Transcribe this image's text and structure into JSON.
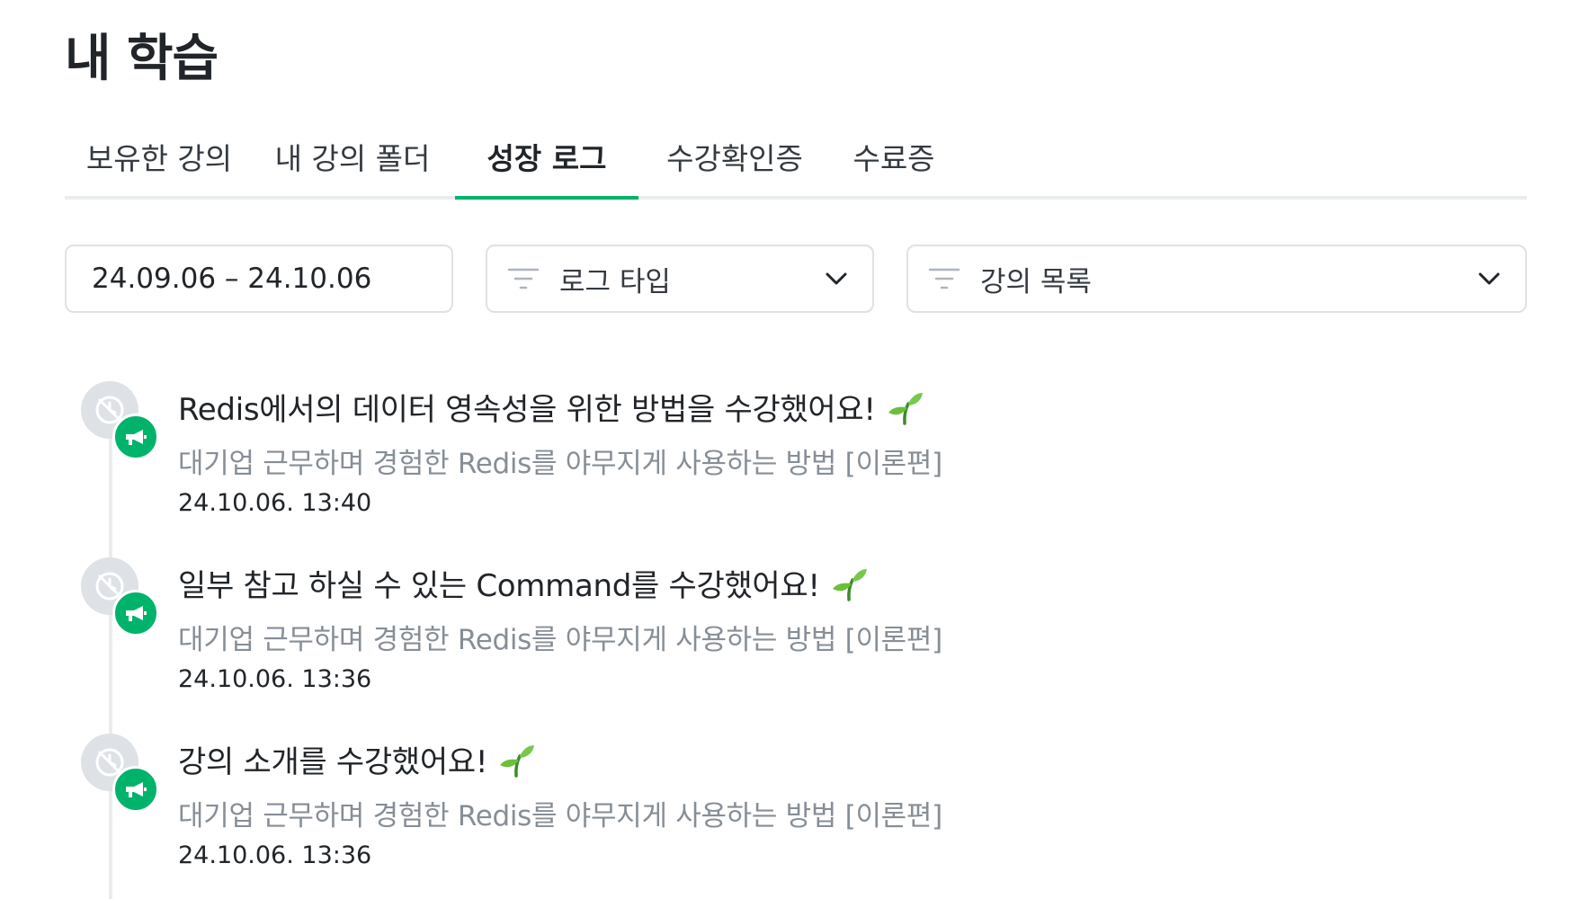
{
  "page": {
    "title": "내 학습"
  },
  "tabs": [
    {
      "label": "보유한 강의",
      "active": false
    },
    {
      "label": "내 강의 폴더",
      "active": false
    },
    {
      "label": "성장 로그",
      "active": true
    },
    {
      "label": "수강확인증",
      "active": false
    },
    {
      "label": "수료증",
      "active": false
    }
  ],
  "filters": {
    "date_range": "24.09.06 – 24.10.06",
    "log_type": {
      "label": "로그 타입",
      "icon": "filter-icon",
      "dropdown_icon": "chevron-down-icon"
    },
    "course_list": {
      "label": "강의 목록",
      "icon": "filter-icon",
      "dropdown_icon": "chevron-down-icon"
    }
  },
  "logs": [
    {
      "title": "Redis에서의 데이터 영속성을 위한 방법을 수강했어요!",
      "course": "대기업 근무하며 경험한 Redis를 야무지게 사용하는 방법 [이론편]",
      "time": "24.10.06. 13:40",
      "icons": [
        "clock-slash-icon",
        "megaphone-icon",
        "sprout-icon"
      ]
    },
    {
      "title": "일부 참고 하실 수 있는 Command를 수강했어요!",
      "course": "대기업 근무하며 경험한 Redis를 야무지게 사용하는 방법 [이론편]",
      "time": "24.10.06. 13:36",
      "icons": [
        "clock-slash-icon",
        "megaphone-icon",
        "sprout-icon"
      ]
    },
    {
      "title": "강의 소개를 수강했어요!",
      "course": "대기업 근무하며 경험한 Redis를 야무지게 사용하는 방법 [이론편]",
      "time": "24.10.06. 13:36",
      "icons": [
        "clock-slash-icon",
        "megaphone-icon",
        "sprout-icon"
      ]
    }
  ],
  "colors": {
    "accent": "#00b36b",
    "tab_underline": "#e9ecef",
    "border": "#dee2e6",
    "muted_text": "#868e96",
    "text": "#212529"
  }
}
